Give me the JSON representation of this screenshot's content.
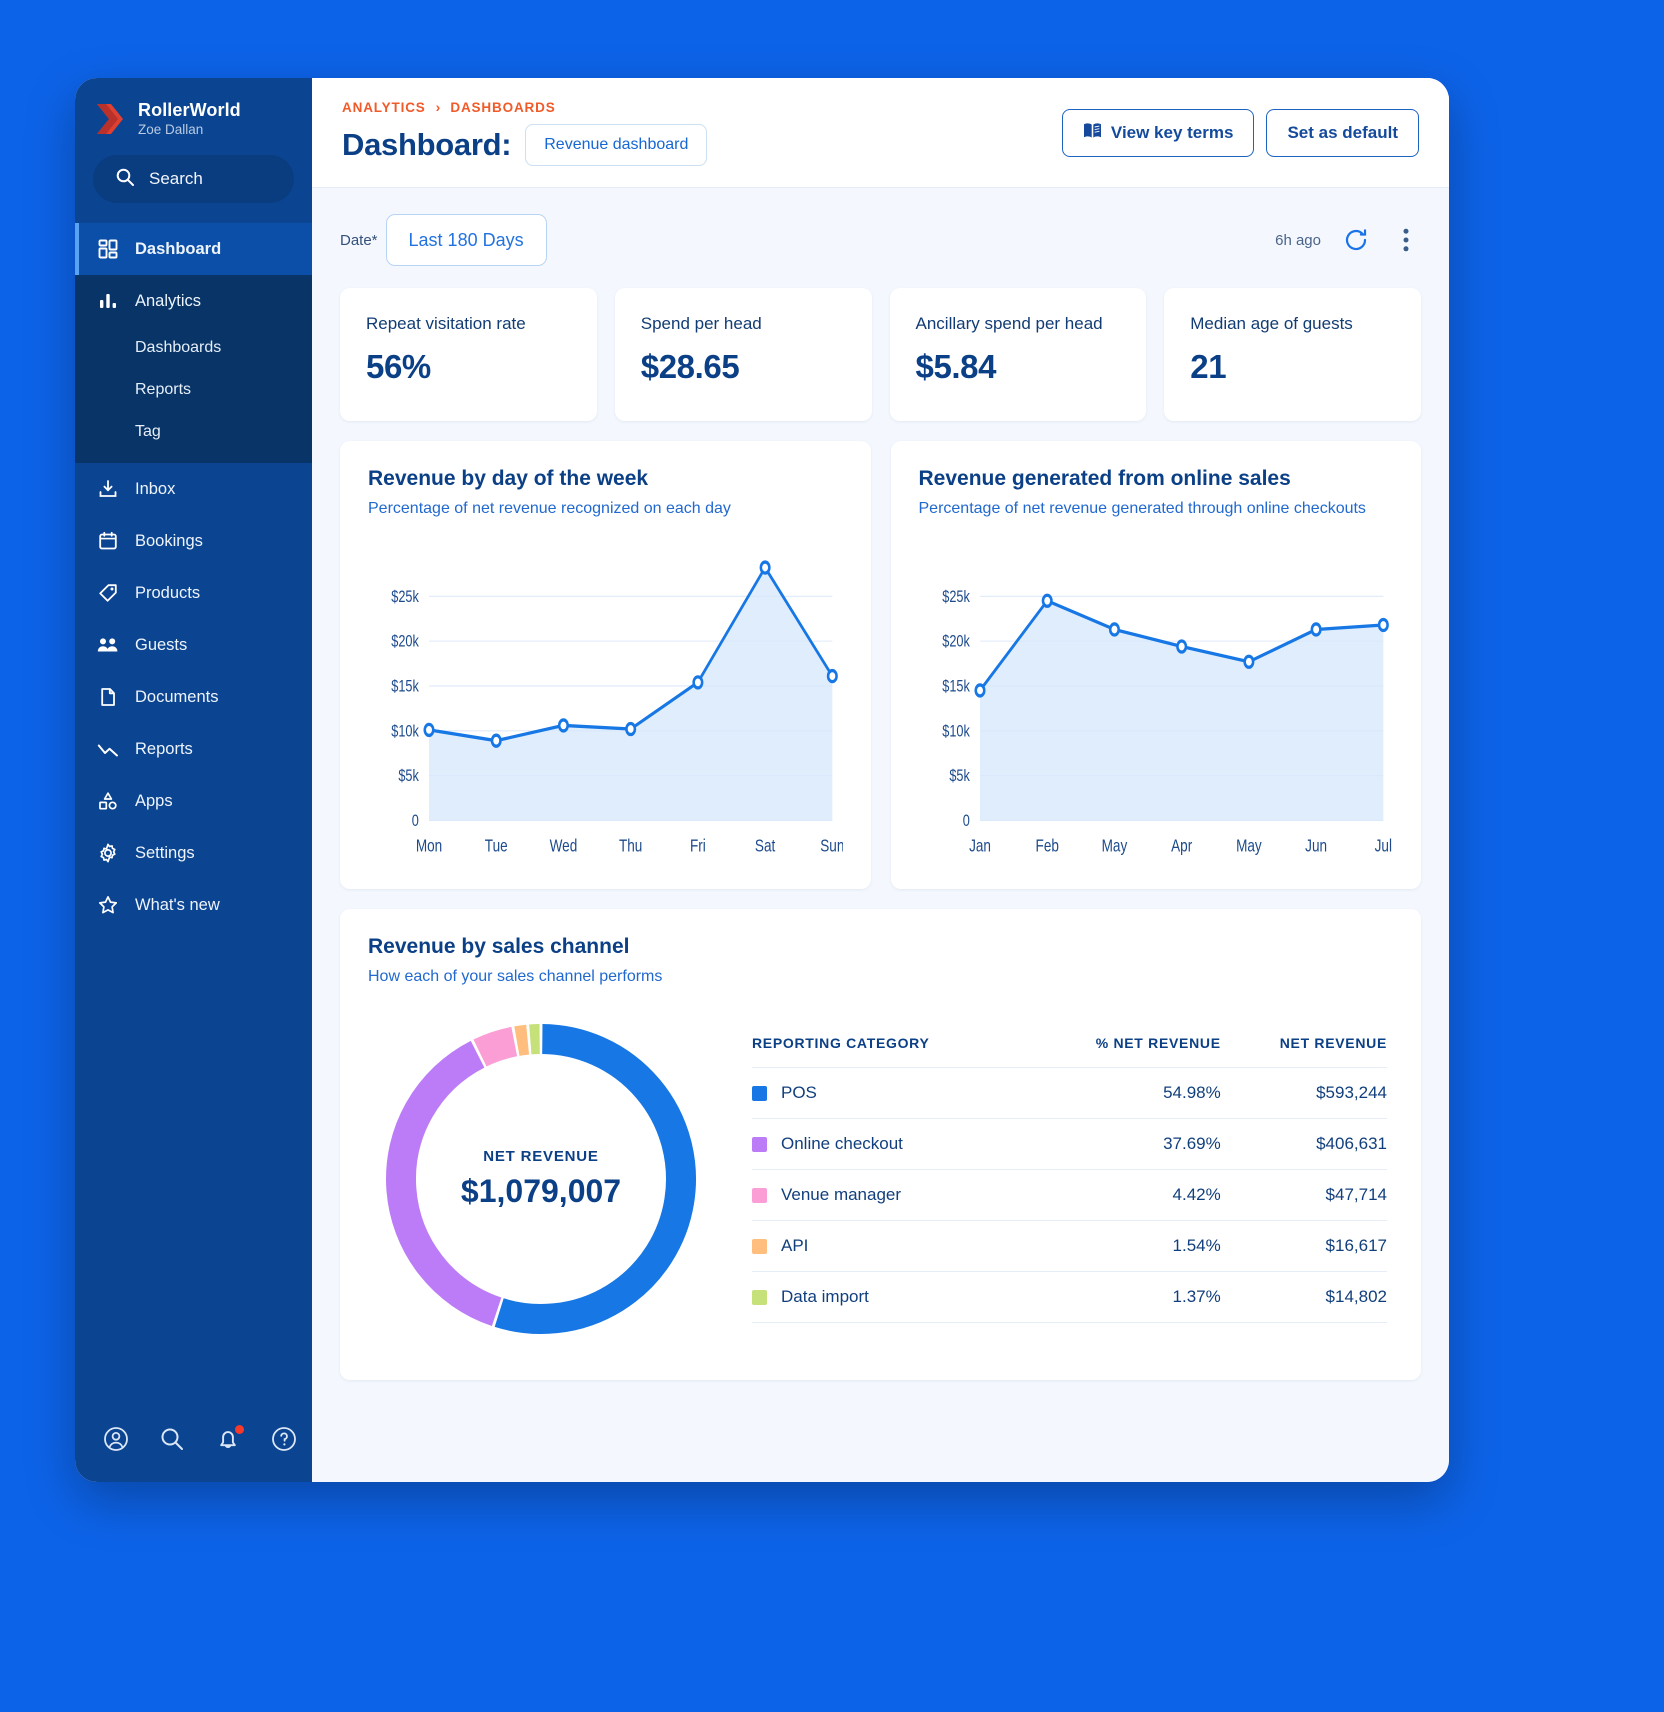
{
  "brand": {
    "name": "RollerWorld",
    "user": "Zoe Dallan",
    "logo_icon": "roller-chevron-logo"
  },
  "search": {
    "label": "Search",
    "icon": "search-icon"
  },
  "sidebar": {
    "primary": [
      {
        "label": "Dashboard",
        "icon": "dashboard-grid-icon",
        "active": true
      }
    ],
    "analytics": {
      "label": "Analytics",
      "icon": "bar-chart-icon",
      "children": [
        {
          "label": "Dashboards"
        },
        {
          "label": "Reports"
        },
        {
          "label": "Tag"
        }
      ]
    },
    "items": [
      {
        "label": "Inbox",
        "icon": "inbox-download-icon"
      },
      {
        "label": "Bookings",
        "icon": "calendar-icon"
      },
      {
        "label": "Products",
        "icon": "tag-icon"
      },
      {
        "label": "Guests",
        "icon": "people-icon"
      },
      {
        "label": "Documents",
        "icon": "document-icon"
      },
      {
        "label": "Reports",
        "icon": "line-chart-icon"
      },
      {
        "label": "Apps",
        "icon": "apps-shapes-icon"
      },
      {
        "label": "Settings",
        "icon": "gear-icon"
      },
      {
        "label": "What's new",
        "icon": "star-icon"
      }
    ],
    "footer_icons": [
      {
        "name": "account-icon"
      },
      {
        "name": "search-icon"
      },
      {
        "name": "notifications-bell-icon",
        "badge": true
      },
      {
        "name": "help-icon"
      }
    ]
  },
  "header": {
    "breadcrumbs": [
      "ANALYTICS",
      "DASHBOARDS"
    ],
    "breadcrumb_separator": "›",
    "title": "Dashboard:",
    "dashboard_chip": "Revenue dashboard",
    "view_key_terms": "View key terms",
    "view_key_terms_icon": "book-icon",
    "set_as_default": "Set as default"
  },
  "filters": {
    "date_label": "Date*",
    "date_value": "Last 180 Days",
    "updated": "6h ago",
    "refresh_icon": "refresh-icon",
    "more_icon": "more-vertical-icon"
  },
  "kpis": [
    {
      "label": "Repeat visitation rate",
      "value": "56%"
    },
    {
      "label": "Spend per head",
      "value": "$28.65"
    },
    {
      "label": "Ancillary spend per head",
      "value": "$5.84"
    },
    {
      "label": "Median age of guests",
      "value": "21"
    }
  ],
  "chart_data": [
    {
      "type": "area",
      "title": "Revenue by day of the week",
      "subtitle": "Percentage of net revenue recognized on each day",
      "categories": [
        "Mon",
        "Tue",
        "Wed",
        "Thu",
        "Fri",
        "Sat",
        "Sun"
      ],
      "values": [
        10100,
        8900,
        10600,
        10200,
        15400,
        28200,
        16100
      ],
      "ylabel": "",
      "xlabel": "",
      "ylim": [
        0,
        30000
      ],
      "yticks": [
        0,
        5000,
        10000,
        15000,
        20000,
        25000
      ],
      "ytick_labels": [
        "0",
        "$5k",
        "$10k",
        "$15k",
        "$20k",
        "$25k"
      ],
      "grid": true,
      "legend": "none",
      "line_color": "#1677e5",
      "fill_color": "#d5e7fb"
    },
    {
      "type": "area",
      "title": "Revenue generated from online sales",
      "subtitle": "Percentage of net revenue generated through online checkouts",
      "categories": [
        "Jan",
        "Feb",
        "May",
        "Apr",
        "May",
        "Jun",
        "Jul"
      ],
      "values": [
        14500,
        24500,
        21300,
        19400,
        17700,
        21300,
        21800
      ],
      "ylabel": "",
      "xlabel": "",
      "ylim": [
        0,
        30000
      ],
      "yticks": [
        0,
        5000,
        10000,
        15000,
        20000,
        25000
      ],
      "ytick_labels": [
        "0",
        "$5k",
        "$10k",
        "$15k",
        "$20k",
        "$25k"
      ],
      "grid": true,
      "legend": "none",
      "line_color": "#1677e5",
      "fill_color": "#d5e7fb"
    },
    {
      "type": "pie",
      "title": "Revenue by sales channel",
      "subtitle": "How each of your sales channel performs",
      "center_caption": "NET REVENUE",
      "center_value": "$1,079,007",
      "labels": [
        "POS",
        "Online checkout",
        "Venue manager",
        "API",
        "Data import"
      ],
      "values": [
        54.98,
        37.69,
        4.42,
        1.54,
        1.37
      ],
      "amounts": [
        "$593,244",
        "$406,631",
        "$47,714",
        "$16,617",
        "$14,802"
      ],
      "colors": [
        "#1677e5",
        "#bc7cf7",
        "#fb9ed6",
        "#ffbe7d",
        "#c6e07a"
      ]
    }
  ],
  "channel_table": {
    "columns": [
      "REPORTING CATEGORY",
      "% NET REVENUE",
      "NET REVENUE"
    ],
    "rows": [
      {
        "category": "POS",
        "percent": "54.98%",
        "amount": "$593,244",
        "color": "#1677e5"
      },
      {
        "category": "Online checkout",
        "percent": "37.69%",
        "amount": "$406,631",
        "color": "#bc7cf7"
      },
      {
        "category": "Venue manager",
        "percent": "4.42%",
        "amount": "$47,714",
        "color": "#fb9ed6"
      },
      {
        "category": "API",
        "percent": "1.54%",
        "amount": "$16,617",
        "color": "#ffbe7d"
      },
      {
        "category": "Data import",
        "percent": "1.37%",
        "amount": "$14,802",
        "color": "#c6e07a"
      }
    ]
  }
}
